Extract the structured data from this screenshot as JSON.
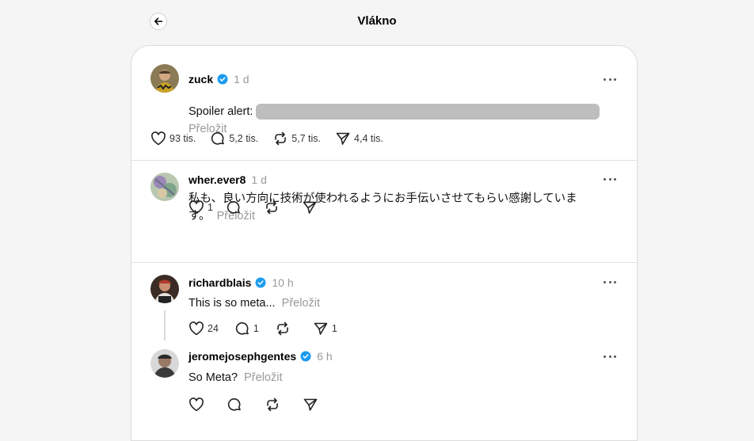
{
  "header": {
    "title": "Vlákno"
  },
  "main_post": {
    "username": "zuck",
    "time": "1 d",
    "text_prefix": "Spoiler alert:",
    "translate": "Přeložit",
    "likes": "93 tis.",
    "replies": "5,2 tis.",
    "reposts": "5,7 tis.",
    "shares": "4,4 tis."
  },
  "replies": [
    {
      "username": "wher.ever8",
      "time": "1 d",
      "text_line1": "私も、良い方向に技術が使われるようにお手伝いさせてもらい感謝していま",
      "text_line2": "す。",
      "translate": "Přeložit",
      "likes": "1",
      "replies": "",
      "reposts": "",
      "shares": ""
    },
    {
      "username": "richardblais",
      "time": "10 h",
      "text": "This is so meta...",
      "translate": "Přeložit",
      "likes": "24",
      "replies": "1",
      "reposts": "",
      "shares": "1"
    },
    {
      "username": "jeromejosephgentes",
      "time": "6 h",
      "text": "So Meta?",
      "translate": "Přeložit",
      "likes": "",
      "replies": "",
      "reposts": "",
      "shares": ""
    }
  ],
  "colors": {
    "verified": "#1d9bf0",
    "muted": "#999999",
    "spoiler": "#bdbdbd"
  }
}
